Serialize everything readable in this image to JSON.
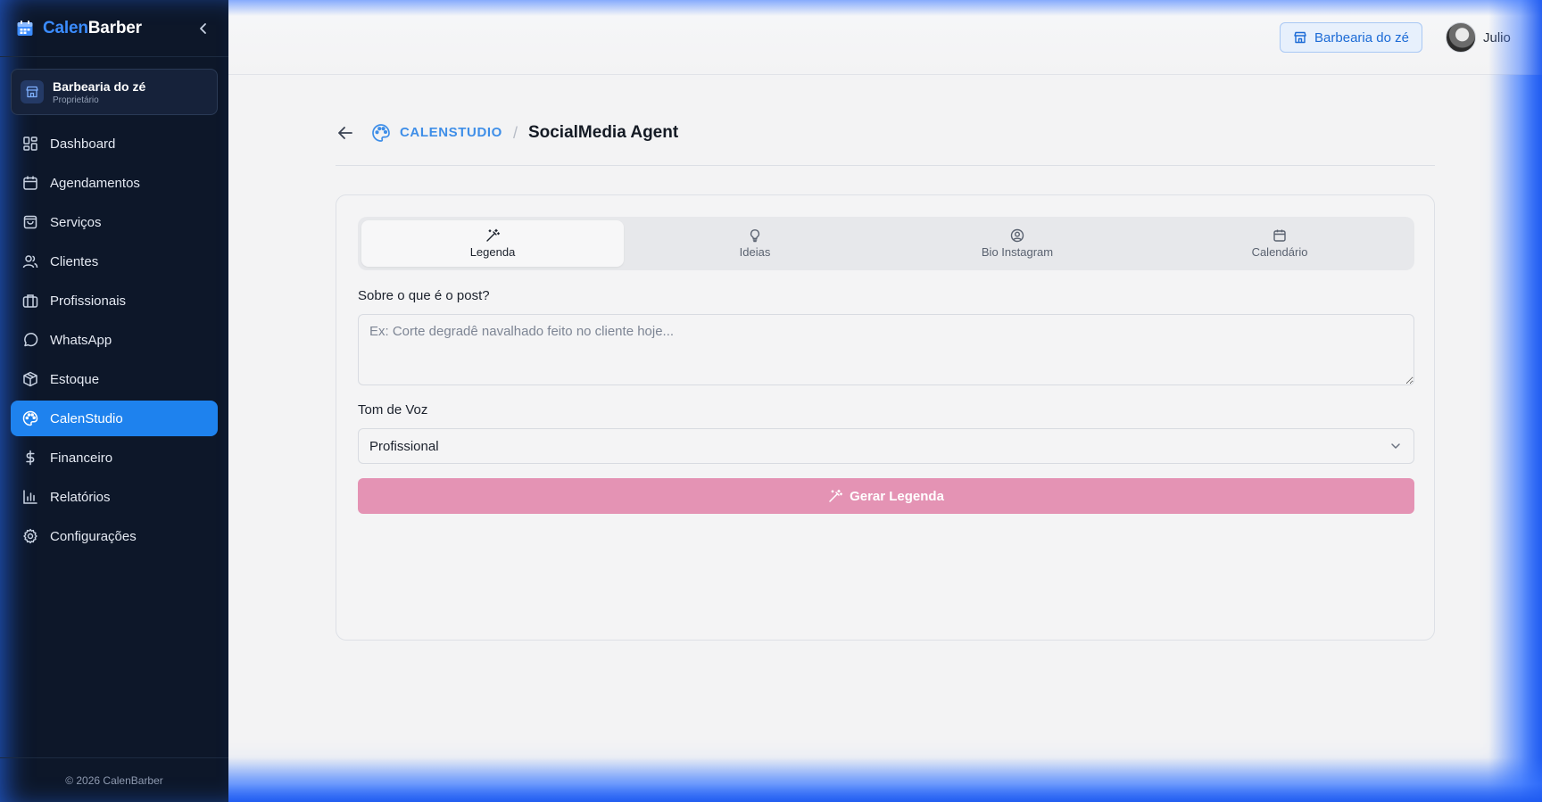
{
  "brand": {
    "part1": "Calen",
    "part2": "Barber"
  },
  "shop": {
    "name": "Barbearia do zé",
    "role": "Proprietário"
  },
  "nav": {
    "items": [
      {
        "label": "Dashboard",
        "icon": "dashboard-icon"
      },
      {
        "label": "Agendamentos",
        "icon": "calendar-icon"
      },
      {
        "label": "Serviços",
        "icon": "shopping-bag-icon"
      },
      {
        "label": "Clientes",
        "icon": "users-icon"
      },
      {
        "label": "Profissionais",
        "icon": "briefcase-icon"
      },
      {
        "label": "WhatsApp",
        "icon": "chat-bubble-icon"
      },
      {
        "label": "Estoque",
        "icon": "package-icon"
      },
      {
        "label": "CalenStudio",
        "icon": "palette-icon"
      },
      {
        "label": "Financeiro",
        "icon": "dollar-icon"
      },
      {
        "label": "Relatórios",
        "icon": "bar-chart-icon"
      },
      {
        "label": "Configurações",
        "icon": "gear-icon"
      }
    ],
    "active_index": 7
  },
  "footer": {
    "copyright": "© 2026 CalenBarber"
  },
  "topbar": {
    "shop_chip": "Barbearia do zé",
    "user_name": "Julio"
  },
  "breadcrumb": {
    "root": "CALENSTUDIO",
    "separator": "/",
    "current": "SocialMedia Agent"
  },
  "tabs": [
    {
      "label": "Legenda",
      "icon": "magic-wand-icon"
    },
    {
      "label": "Ideias",
      "icon": "lightbulb-icon"
    },
    {
      "label": "Bio Instagram",
      "icon": "user-circle-icon"
    },
    {
      "label": "Calendário",
      "icon": "calendar-icon"
    }
  ],
  "form": {
    "post_label": "Sobre o que é o post?",
    "post_placeholder": "Ex: Corte degradê navalhado feito no cliente hoje...",
    "post_value": "",
    "tone_label": "Tom de Voz",
    "tone_value": "Profissional",
    "generate_label": "Gerar Legenda"
  },
  "colors": {
    "sidebar_bg": "#0d1729",
    "accent_blue": "#1e82ee",
    "brand_blue": "#3b8cff",
    "generate_button": "#e493b4"
  }
}
